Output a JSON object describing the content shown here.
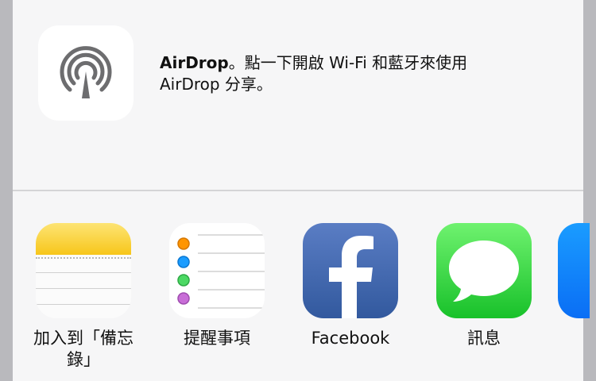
{
  "airdrop": {
    "title": "AirDrop",
    "message": "。點一下開啟 Wi-Fi 和藍牙來使用 AirDrop 分享。",
    "icon": "airdrop-icon"
  },
  "apps": [
    {
      "label": "加入到「備忘錄」",
      "icon": "notes-icon"
    },
    {
      "label": "提醒事項",
      "icon": "reminders-icon"
    },
    {
      "label": "Facebook",
      "icon": "facebook-icon"
    },
    {
      "label": "訊息",
      "icon": "messages-icon"
    }
  ],
  "colors": {
    "notes_yellow": "#f7c61a",
    "facebook_blue": "#3b5998",
    "messages_green": "#18c12a",
    "reminder_dots": [
      "#ff9500",
      "#1a9cff",
      "#4cd964",
      "#c86dd7"
    ]
  }
}
